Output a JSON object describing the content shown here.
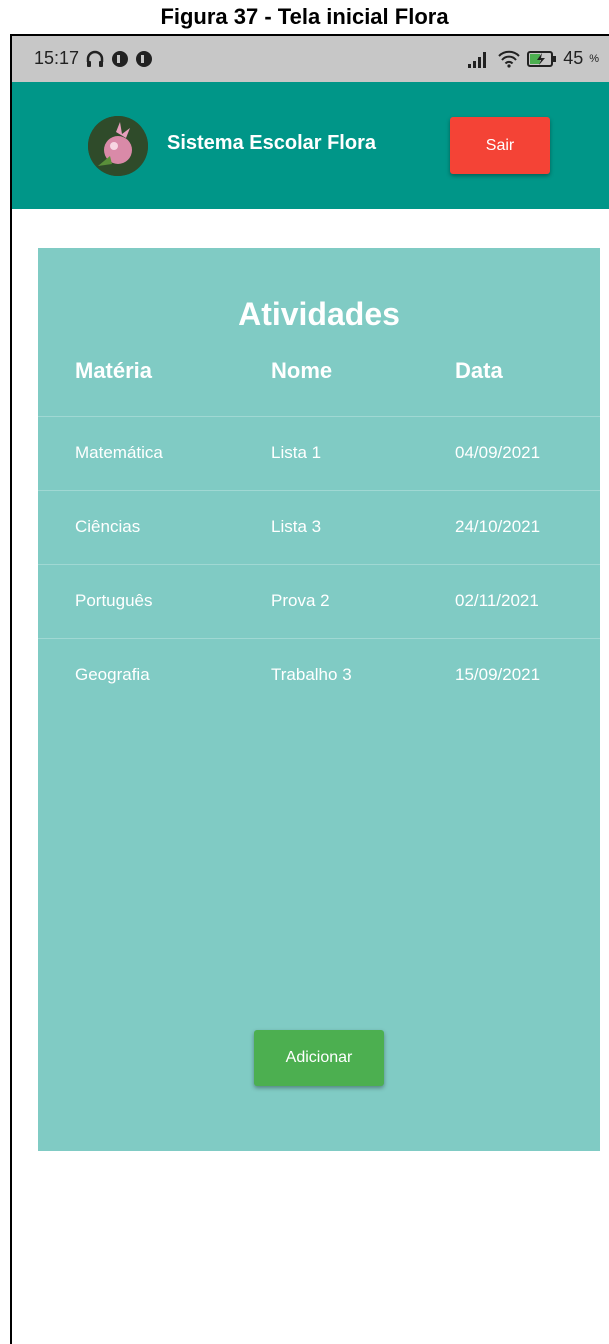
{
  "caption": "Figura 37 - Tela inicial Flora",
  "statusbar": {
    "time": "15:17",
    "battery": "45"
  },
  "appbar": {
    "title": "Sistema Escolar Flora",
    "logout_label": "Sair"
  },
  "activities": {
    "title": "Atividades",
    "columns": [
      "Matéria",
      "Nome",
      "Data"
    ],
    "rows": [
      {
        "subject": "Matemática",
        "name": "Lista 1",
        "date": "04/09/2021"
      },
      {
        "subject": "Ciências",
        "name": "Lista 3",
        "date": "24/10/2021"
      },
      {
        "subject": "Português",
        "name": "Prova 2",
        "date": "02/11/2021"
      },
      {
        "subject": "Geografia",
        "name": "Trabalho 3",
        "date": "15/09/2021"
      }
    ],
    "add_label": "Adicionar"
  },
  "colors": {
    "appbar": "#009688",
    "card": "#80cbc4",
    "logout": "#f44336",
    "add": "#4caf50"
  }
}
